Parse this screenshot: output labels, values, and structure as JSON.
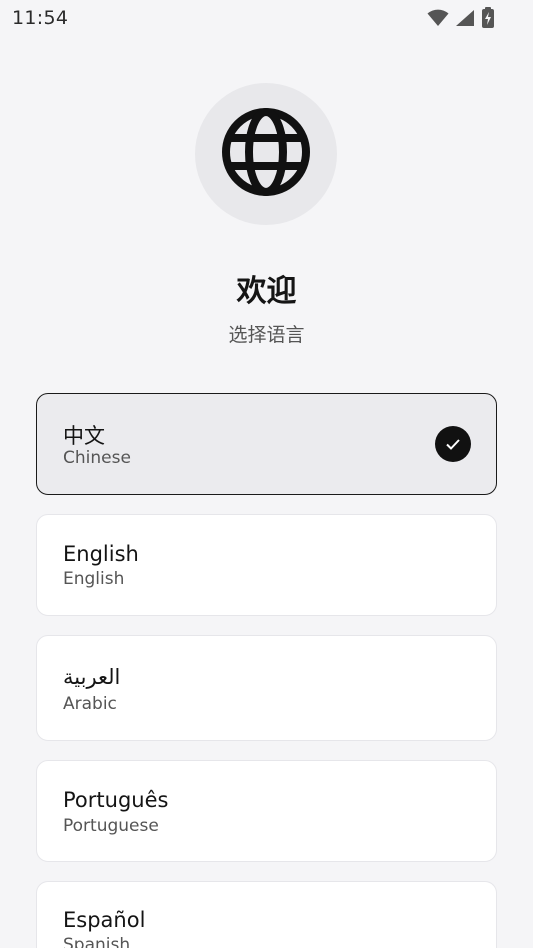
{
  "status_bar": {
    "time": "11:54",
    "icons": [
      "wifi-icon",
      "signal-icon",
      "battery-charging-icon"
    ]
  },
  "header": {
    "icon": "globe-icon",
    "title": "欢迎",
    "subtitle": "选择语言"
  },
  "languages": [
    {
      "native": "中文",
      "english": "Chinese",
      "selected": true
    },
    {
      "native": "English",
      "english": "English",
      "selected": false
    },
    {
      "native": "العربية",
      "english": "Arabic",
      "selected": false
    },
    {
      "native": "Português",
      "english": "Portuguese",
      "selected": false
    },
    {
      "native": "Español",
      "english": "Spanish",
      "selected": false
    }
  ],
  "colors": {
    "background": "#f5f5f7",
    "selected_card": "#ebebee",
    "accent": "#111111"
  }
}
